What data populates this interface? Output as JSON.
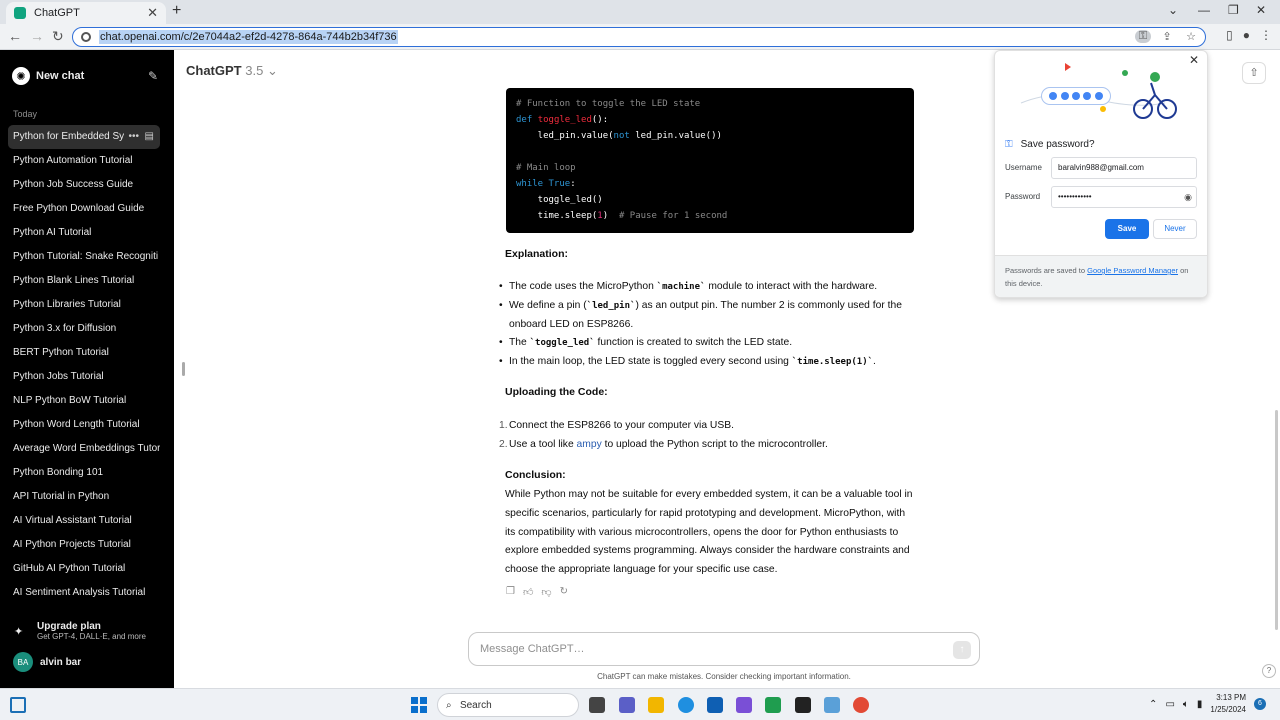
{
  "browser": {
    "tab_title": "ChatGPT",
    "url": "chat.openai.com/c/2e7044a2-ef2d-4278-864a-744b2b34f736"
  },
  "sidebar": {
    "new_chat": "New chat",
    "section_today": "Today",
    "items": [
      "Python for Embedded Sys",
      "Python Automation Tutorial",
      "Python Job Success Guide",
      "Free Python Download Guide",
      "Python AI Tutorial",
      "Python Tutorial: Snake Recogniti",
      "Python Blank Lines Tutorial",
      "Python Libraries Tutorial",
      "Python 3.x for Diffusion",
      "BERT Python Tutorial",
      "Python Jobs Tutorial",
      "NLP Python BoW Tutorial",
      "Python Word Length Tutorial",
      "Average Word Embeddings Tutor",
      "Python Bonding 101",
      "API Tutorial in Python",
      "AI Virtual Assistant Tutorial",
      "AI Python Projects Tutorial",
      "GitHub AI Python Tutorial",
      "AI Sentiment Analysis Tutorial"
    ],
    "upgrade_title": "Upgrade plan",
    "upgrade_sub": "Get GPT-4, DALL·E, and more",
    "user_initials": "BA",
    "user_name": "alvin bar"
  },
  "header": {
    "model": "ChatGPT",
    "version": "3.5"
  },
  "code": {
    "c1": "# Function to toggle the LED state",
    "def": "def",
    "fname": "toggle_led",
    "sig_tail": "():",
    "l3a": "    led_pin.value(",
    "l3not": "not",
    "l3b": " led_pin.value())",
    "c2": "# Main loop",
    "while": "while",
    "true": "True",
    "colon": ":",
    "l6": "    toggle_led()",
    "l7a": "    time.sleep(",
    "l7n": "1",
    "l7b": ")  ",
    "l7c": "# Pause for 1 second"
  },
  "explanation": {
    "heading": "Explanation:",
    "b1a": "The code uses the MicroPython ",
    "b1c": "`machine`",
    "b1b": " module to interact with the hardware.",
    "b2a": "We define a pin (",
    "b2c": "`led_pin`",
    "b2b": ") as an output pin. The number 2 is commonly used for the onboard LED on ESP8266.",
    "b3a": "The ",
    "b3c": "`toggle_led`",
    "b3b": " function is created to switch the LED state.",
    "b4a": "In the main loop, the LED state is toggled every second using ",
    "b4c": "`time.sleep(1)`",
    "b4b": "."
  },
  "uploading": {
    "heading": "Uploading the Code:",
    "n1": "1.",
    "s1": "Connect the ESP8266 to your computer via USB.",
    "n2": "2.",
    "s2a": "Use a tool like ",
    "s2link": "ampy",
    "s2b": " to upload the Python script to the microcontroller."
  },
  "conclusion": {
    "heading": "Conclusion:",
    "text": "While Python may not be suitable for every embedded system, it can be a valuable tool in specific scenarios, particularly for rapid prototyping and development. MicroPython, with its compatibility with various microcontrollers, opens the door for Python enthusiasts to explore embedded systems programming. Always consider the hardware constraints and choose the appropriate language for your specific use case."
  },
  "composer": {
    "placeholder": "Message ChatGPT…",
    "disclaimer": "ChatGPT can make mistakes. Consider checking important information."
  },
  "password_popup": {
    "title": "Save password?",
    "username_label": "Username",
    "username_value": "baralvin988@gmail.com",
    "password_label": "Password",
    "password_value": "••••••••••••",
    "save": "Save",
    "never": "Never",
    "footer_a": "Passwords are saved to ",
    "footer_link": "Google Password Manager",
    "footer_b": " on this device."
  },
  "taskbar": {
    "search": "Search",
    "time": "3:13 PM",
    "date": "1/25/2024",
    "notifications": "6"
  },
  "colors": {
    "sidebar_bg": "#000000",
    "accent_blue": "#1a73e8"
  }
}
